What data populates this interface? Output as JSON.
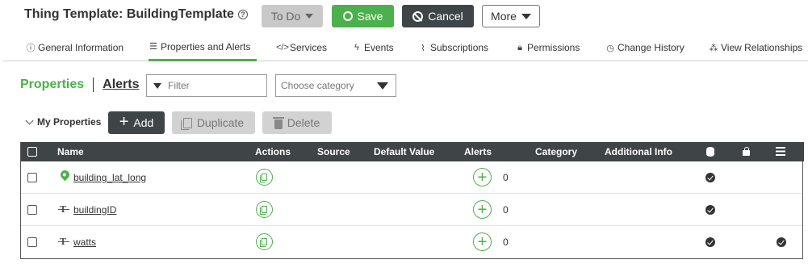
{
  "header": {
    "title": "Thing Template: BuildingTemplate",
    "todo_label": "To Do",
    "save_label": "Save",
    "cancel_label": "Cancel",
    "more_label": "More"
  },
  "tabs": [
    {
      "label": "General Information",
      "icon": "info-icon",
      "active": false
    },
    {
      "label": "Properties and Alerts",
      "icon": "list-icon",
      "active": true
    },
    {
      "label": "Services",
      "icon": "code-icon",
      "active": false
    },
    {
      "label": "Events",
      "icon": "lightning-icon",
      "active": false
    },
    {
      "label": "Subscriptions",
      "icon": "rss-icon",
      "active": false
    },
    {
      "label": "Permissions",
      "icon": "lock-icon",
      "active": false
    },
    {
      "label": "Change History",
      "icon": "clock-icon",
      "active": false
    },
    {
      "label": "View Relationships",
      "icon": "hierarchy-icon",
      "active": false
    }
  ],
  "section": {
    "properties_label": "Properties",
    "alerts_label": "Alerts",
    "filter_placeholder": "Filter",
    "category_placeholder": "Choose category",
    "my_properties_label": "My Properties",
    "add_label": "Add",
    "duplicate_label": "Duplicate",
    "delete_label": "Delete"
  },
  "table": {
    "columns": [
      "Name",
      "Actions",
      "Source",
      "Default Value",
      "Alerts",
      "Category",
      "Additional Info"
    ],
    "icon_columns": [
      "database-icon",
      "lock-icon",
      "list-icon"
    ],
    "rows": [
      {
        "name": "building_lat_long",
        "type_icon": "location-pin-icon",
        "alerts": "0",
        "persistent": true,
        "readonly": false,
        "logged": false
      },
      {
        "name": "buildingID",
        "type_icon": "string-type-icon",
        "alerts": "0",
        "persistent": true,
        "readonly": false,
        "logged": false
      },
      {
        "name": "watts",
        "type_icon": "string-type-icon",
        "alerts": "0",
        "persistent": true,
        "readonly": false,
        "logged": true
      }
    ]
  },
  "colors": {
    "accent_green": "#4cb04c",
    "dark_header": "#3f4546"
  }
}
